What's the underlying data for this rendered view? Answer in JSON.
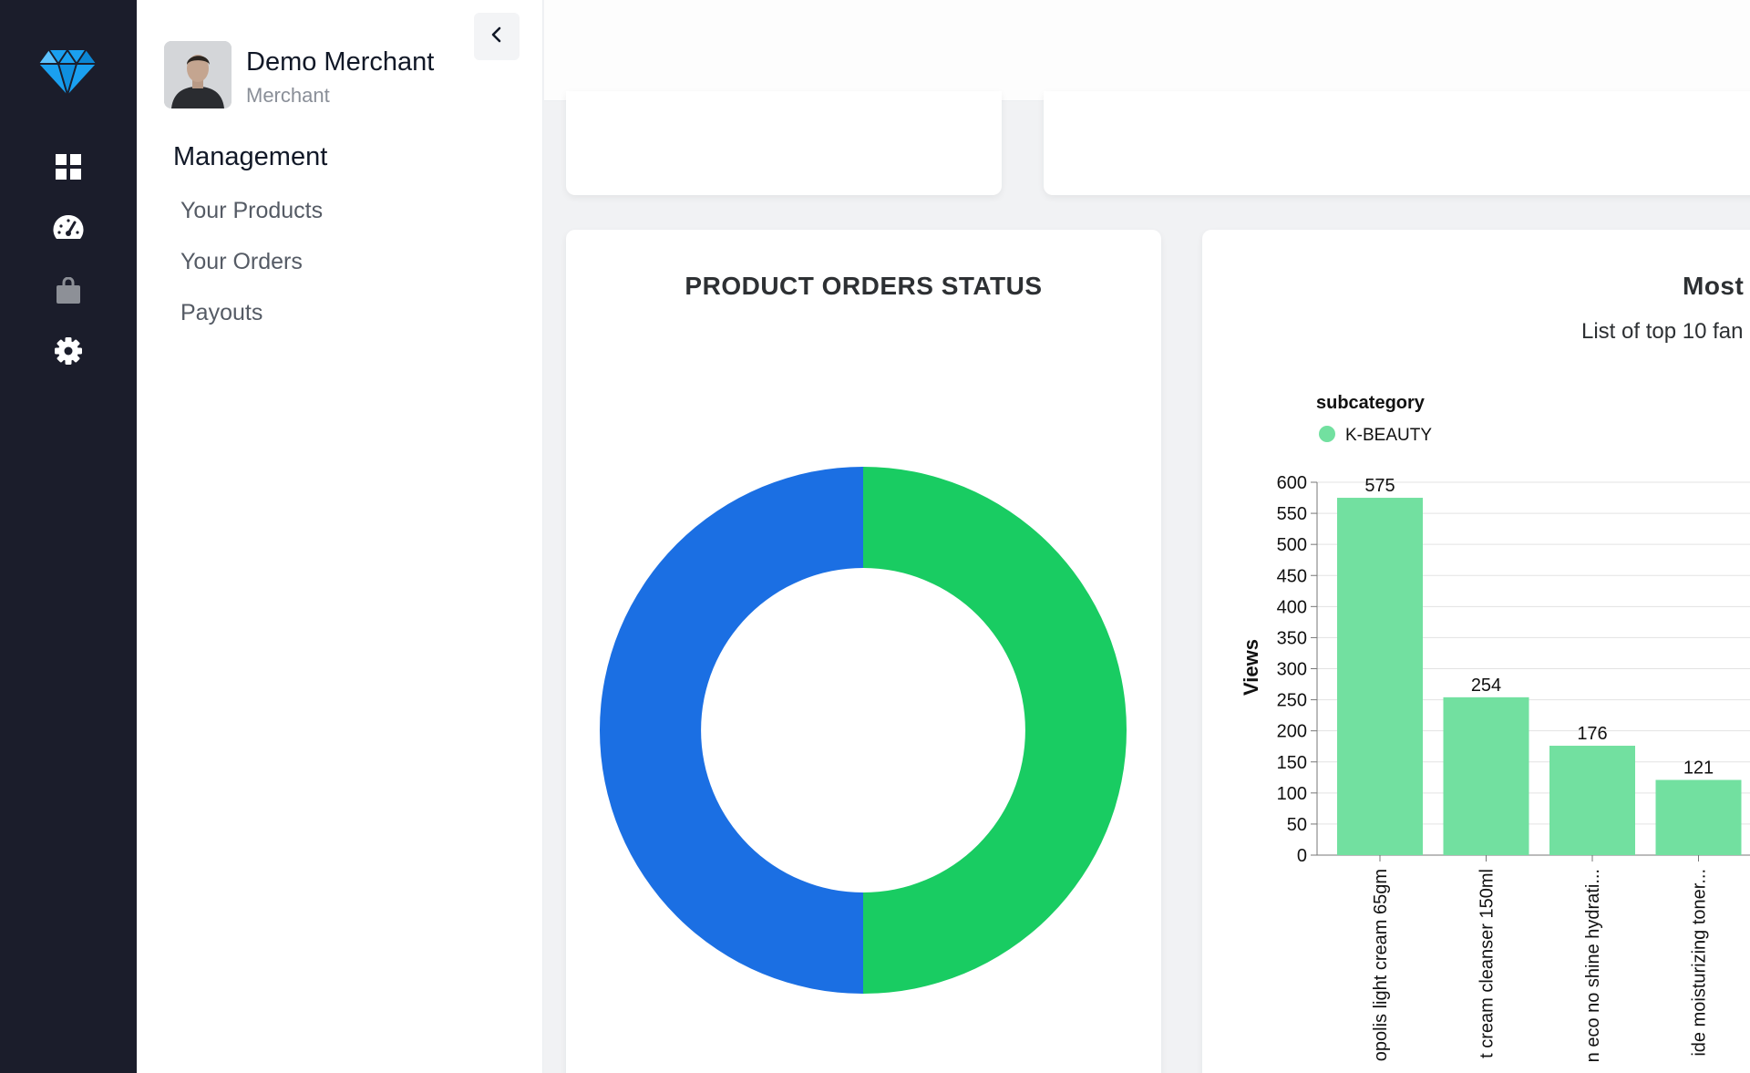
{
  "app": {
    "brand_color": "#1aa0f0",
    "rail_color": "#1b1d2b"
  },
  "rail": {
    "items": [
      {
        "icon": "dashboard-grid-icon"
      },
      {
        "icon": "speedometer-icon"
      },
      {
        "icon": "shopping-bag-icon"
      },
      {
        "icon": "gear-icon"
      }
    ]
  },
  "user": {
    "name": "Demo Merchant",
    "role": "Merchant"
  },
  "sidebar": {
    "section_title": "Management",
    "items": [
      {
        "label": "Your Products"
      },
      {
        "label": "Your Orders"
      },
      {
        "label": "Payouts"
      }
    ]
  },
  "donut_card": {
    "title": "PRODUCT ORDERS STATUS"
  },
  "bar_card": {
    "title": "Most",
    "subtitle": "List of top 10 fan"
  },
  "chart_data": [
    {
      "type": "pie",
      "title": "PRODUCT ORDERS STATUS",
      "donut": true,
      "values": [
        50,
        50
      ],
      "colors": [
        "#19cc62",
        "#1b6fe3"
      ]
    },
    {
      "type": "bar",
      "title": "Most",
      "subtitle": "List of top 10 fan",
      "legend_title": "subcategory",
      "legend": [
        {
          "name": "K-BEAUTY",
          "color": "#72e0a0"
        }
      ],
      "legend_position": "top-left",
      "ylabel": "Views",
      "ylim": [
        0,
        600
      ],
      "yticks": [
        0,
        50,
        100,
        150,
        200,
        250,
        300,
        350,
        400,
        450,
        500,
        550,
        600
      ],
      "grid": true,
      "categories": [
        "opolis light cream 65gm",
        "t cream cleanser 150ml",
        "n eco no shine hydrati...",
        "ide moisturizing toner..."
      ],
      "series": [
        {
          "name": "K-BEAUTY",
          "values": [
            575,
            254,
            176,
            121
          ]
        }
      ],
      "data_labels": [
        "575",
        "254",
        "176",
        "121"
      ]
    }
  ]
}
